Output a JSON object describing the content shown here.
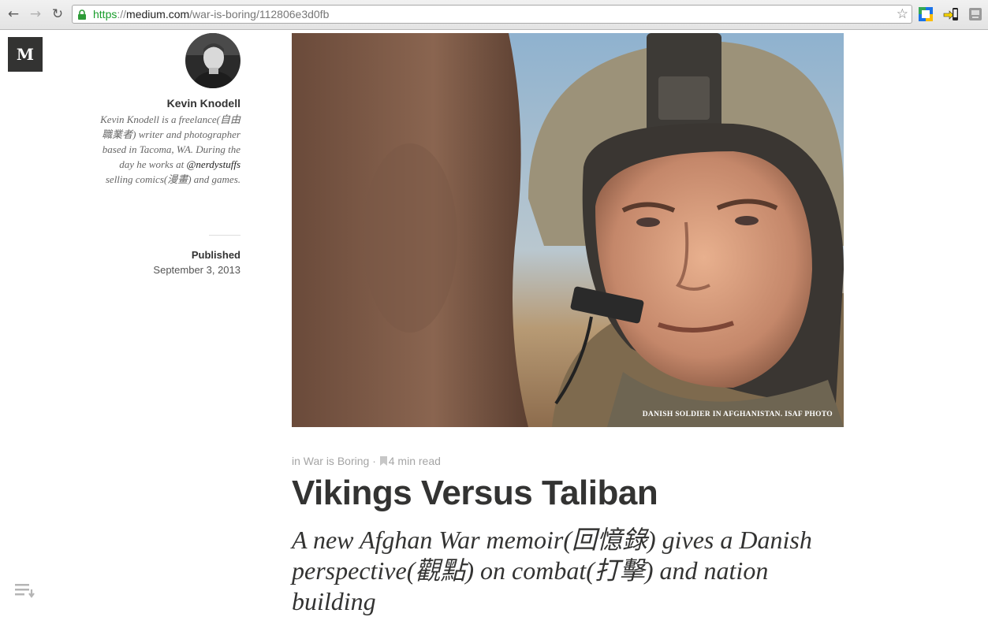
{
  "browser": {
    "url_scheme": "https",
    "url_sep": "://",
    "url_host": "medium.com",
    "url_path": "/war-is-boring/112806e3d0fb",
    "icons": [
      "back-arrow",
      "forward-arrow",
      "reload",
      "lock",
      "bookmark-star",
      "extension-cast",
      "extension-phone",
      "extension-tag"
    ]
  },
  "site": {
    "logo": "M"
  },
  "author": {
    "name": "Kevin Knodell",
    "bio_before": "Kevin Knodell is a freelance(自由職業者) writer and photographer based in Tacoma, WA. During the day he works at ",
    "bio_handle": "@nerdystuffs",
    "bio_after": " selling comics(漫畫) and games."
  },
  "published": {
    "label": "Published",
    "date": "September 3, 2013"
  },
  "hero": {
    "caption": "DANISH SOLDIER IN AFGHANISTAN. ISAF PHOTO"
  },
  "article": {
    "collection": "in War is Boring",
    "separator": "·",
    "read_time": "4 min read",
    "title": "Vikings Versus Taliban",
    "subtitle": "A new Afghan War memoir(回憶錄) gives a Danish perspective(觀點) on combat(打擊) and nation building"
  },
  "colors": {
    "text": "#333332",
    "meta": "#a5a5a5",
    "url_green": "#179c2a"
  }
}
